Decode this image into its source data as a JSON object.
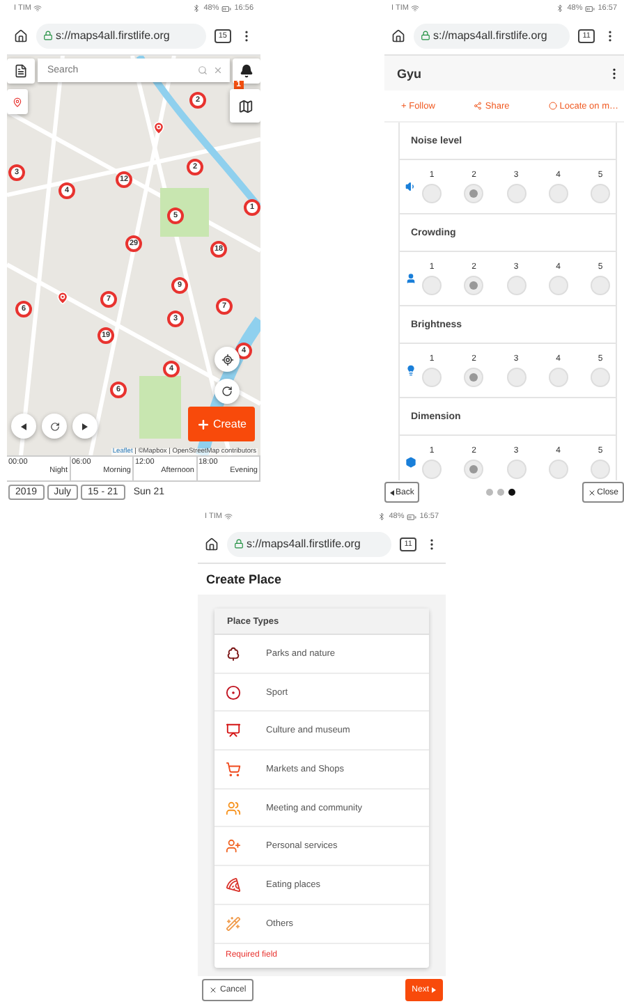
{
  "map_screen": {
    "status": {
      "carrier": "I TIM",
      "battery": "48%",
      "time": "16:56"
    },
    "browser": {
      "url": "s://maps4all.firstlife.org",
      "tabs": "15"
    },
    "search": {
      "placeholder": "Search"
    },
    "notifications": "1",
    "markers": [
      "2",
      "2",
      "3",
      "12",
      "4",
      "1",
      "5",
      "29",
      "18",
      "9",
      "7",
      "6",
      "7",
      "3",
      "19",
      "4",
      "4",
      "6"
    ],
    "create": "Create",
    "attribution": {
      "link": "Leaflet",
      "text": "| ©Mapbox | OpenStreetMap contributors"
    },
    "timeline": [
      {
        "time": "00:00",
        "label": "Night"
      },
      {
        "time": "06:00",
        "label": "Morning"
      },
      {
        "time": "12:00",
        "label": "Afternoon"
      },
      {
        "time": "18:00",
        "label": "Evening"
      }
    ],
    "dates": [
      {
        "label": "2019",
        "kind": "box"
      },
      {
        "label": "July",
        "kind": "box"
      },
      {
        "label": "15 - 21",
        "kind": "box"
      },
      {
        "label": "Sun 21",
        "kind": "plain"
      }
    ]
  },
  "detail_screen": {
    "status": {
      "carrier": "I TIM",
      "battery": "48%",
      "time": "16:57"
    },
    "browser": {
      "url": "s://maps4all.firstlife.org",
      "tabs": "11"
    },
    "title": "Gyu",
    "actions": [
      {
        "kind": "follow",
        "label": "+ Follow"
      },
      {
        "kind": "share",
        "label": "Share"
      },
      {
        "kind": "locate",
        "label": "Locate on m…"
      }
    ],
    "sections": [
      {
        "kind": "noise",
        "title": "Noise level",
        "options": [
          {
            "label": "1",
            "selected": false
          },
          {
            "label": "2",
            "selected": true
          },
          {
            "label": "3",
            "selected": false
          },
          {
            "label": "4",
            "selected": false
          },
          {
            "label": "5",
            "selected": false
          }
        ]
      },
      {
        "kind": "crowding",
        "title": "Crowding",
        "options": [
          {
            "label": "1",
            "selected": false
          },
          {
            "label": "2",
            "selected": true
          },
          {
            "label": "3",
            "selected": false
          },
          {
            "label": "4",
            "selected": false
          },
          {
            "label": "5",
            "selected": false
          }
        ]
      },
      {
        "kind": "brightness",
        "title": "Brightness",
        "options": [
          {
            "label": "1",
            "selected": false
          },
          {
            "label": "2",
            "selected": true
          },
          {
            "label": "3",
            "selected": false
          },
          {
            "label": "4",
            "selected": false
          },
          {
            "label": "5",
            "selected": false
          }
        ]
      },
      {
        "kind": "dimension",
        "title": "Dimension",
        "options": [
          {
            "label": "1",
            "selected": false
          },
          {
            "label": "2",
            "selected": true
          },
          {
            "label": "3",
            "selected": false
          },
          {
            "label": "4",
            "selected": false
          },
          {
            "label": "5",
            "selected": false
          }
        ]
      }
    ],
    "pager": [
      {
        "selected": false
      },
      {
        "selected": false
      },
      {
        "selected": true
      }
    ],
    "back": "Back",
    "close": "Close"
  },
  "create_screen": {
    "status": {
      "carrier": "I TIM",
      "battery": "48%",
      "time": "16:57"
    },
    "browser": {
      "url": "s://maps4all.firstlife.org",
      "tabs": "11"
    },
    "title": "Create Place",
    "card_title": "Place Types",
    "types": [
      {
        "kind": "parks",
        "label": "Parks and nature"
      },
      {
        "kind": "sport",
        "label": "Sport"
      },
      {
        "kind": "culture",
        "label": "Culture and museum"
      },
      {
        "kind": "markets",
        "label": "Markets and Shops"
      },
      {
        "kind": "meeting",
        "label": "Meeting and community"
      },
      {
        "kind": "personal",
        "label": "Personal services"
      },
      {
        "kind": "eating",
        "label": "Eating places"
      },
      {
        "kind": "others",
        "label": "Others"
      }
    ],
    "error": "Required field",
    "cancel": "Cancel",
    "next": "Next"
  }
}
